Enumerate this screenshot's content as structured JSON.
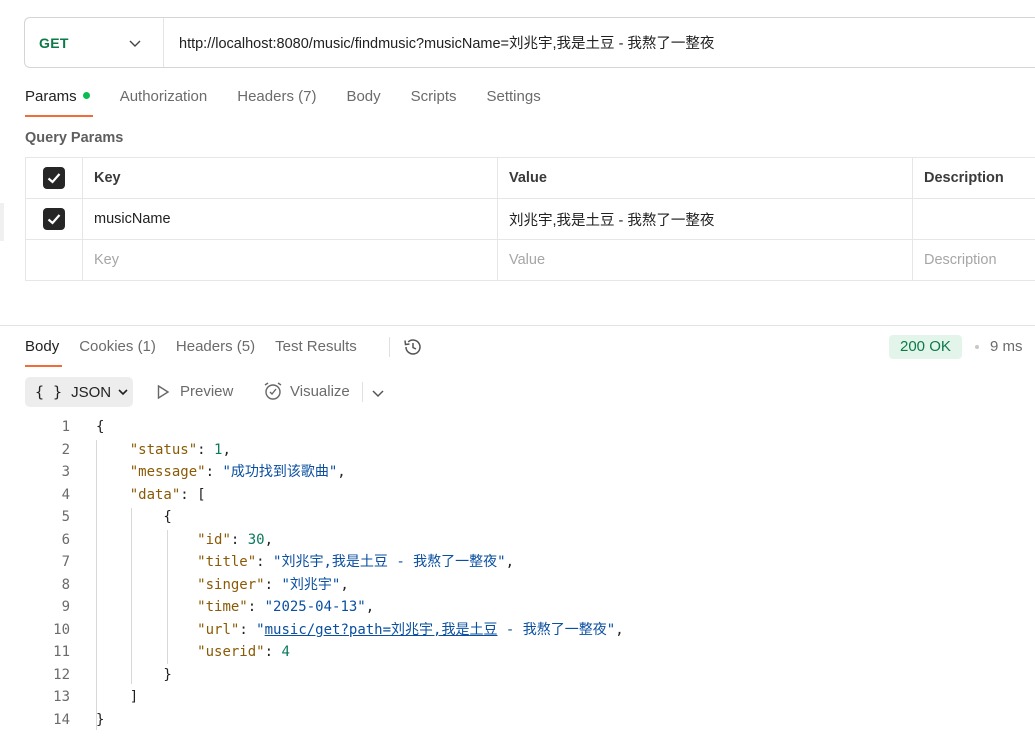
{
  "request": {
    "method": "GET",
    "url": "http://localhost:8080/music/findmusic?musicName=刘兆宇,我是土豆 - 我熬了一整夜"
  },
  "request_tabs": [
    {
      "label": "Params"
    },
    {
      "label": "Authorization"
    },
    {
      "label": "Headers (7)"
    },
    {
      "label": "Body"
    },
    {
      "label": "Scripts"
    },
    {
      "label": "Settings"
    }
  ],
  "query_params": {
    "title": "Query Params",
    "headers": {
      "key": "Key",
      "value": "Value",
      "description": "Description"
    },
    "rows": [
      {
        "checked": true,
        "key": "musicName",
        "value": "刘兆宇,我是土豆 - 我熬了一整夜",
        "description": ""
      }
    ],
    "placeholders": {
      "key": "Key",
      "value": "Value",
      "description": "Description"
    }
  },
  "response_tabs": [
    {
      "label": "Body"
    },
    {
      "label": "Cookies (1)"
    },
    {
      "label": "Headers (5)"
    },
    {
      "label": "Test Results"
    }
  ],
  "status": {
    "badge": "200 OK",
    "time": "9 ms"
  },
  "format": {
    "braces": "{ }",
    "label": "JSON",
    "preview": "Preview",
    "visualize": "Visualize"
  },
  "code_lines": [
    {
      "n": "1"
    },
    {
      "n": "2"
    },
    {
      "n": "3"
    },
    {
      "n": "4"
    },
    {
      "n": "5"
    },
    {
      "n": "6"
    },
    {
      "n": "7"
    },
    {
      "n": "8"
    },
    {
      "n": "9"
    },
    {
      "n": "10"
    },
    {
      "n": "11"
    },
    {
      "n": "12"
    },
    {
      "n": "13"
    },
    {
      "n": "14"
    }
  ],
  "json_body": {
    "status_key": "\"status\"",
    "status_val": "1",
    "message_key": "\"message\"",
    "message_val": "\"成功找到该歌曲\"",
    "data_key": "\"data\"",
    "id_key": "\"id\"",
    "id_val": "30",
    "title_key": "\"title\"",
    "title_val": "\"刘兆宇,我是土豆 - 我熬了一整夜\"",
    "singer_key": "\"singer\"",
    "singer_val": "\"刘兆宇\"",
    "time_key": "\"time\"",
    "time_val": "\"2025-04-13\"",
    "url_key": "\"url\"",
    "url_q1": "\"",
    "url_link": "music/get?path=刘兆宇,我是土豆",
    "url_rest": " - 我熬了一整夜\"",
    "userid_key": "\"userid\"",
    "userid_val": "4"
  },
  "colors": {
    "accent": "#f26b3a",
    "method": "#0b7a49",
    "ok_bg": "#e3f5ea",
    "dot": "#0cbb52"
  }
}
